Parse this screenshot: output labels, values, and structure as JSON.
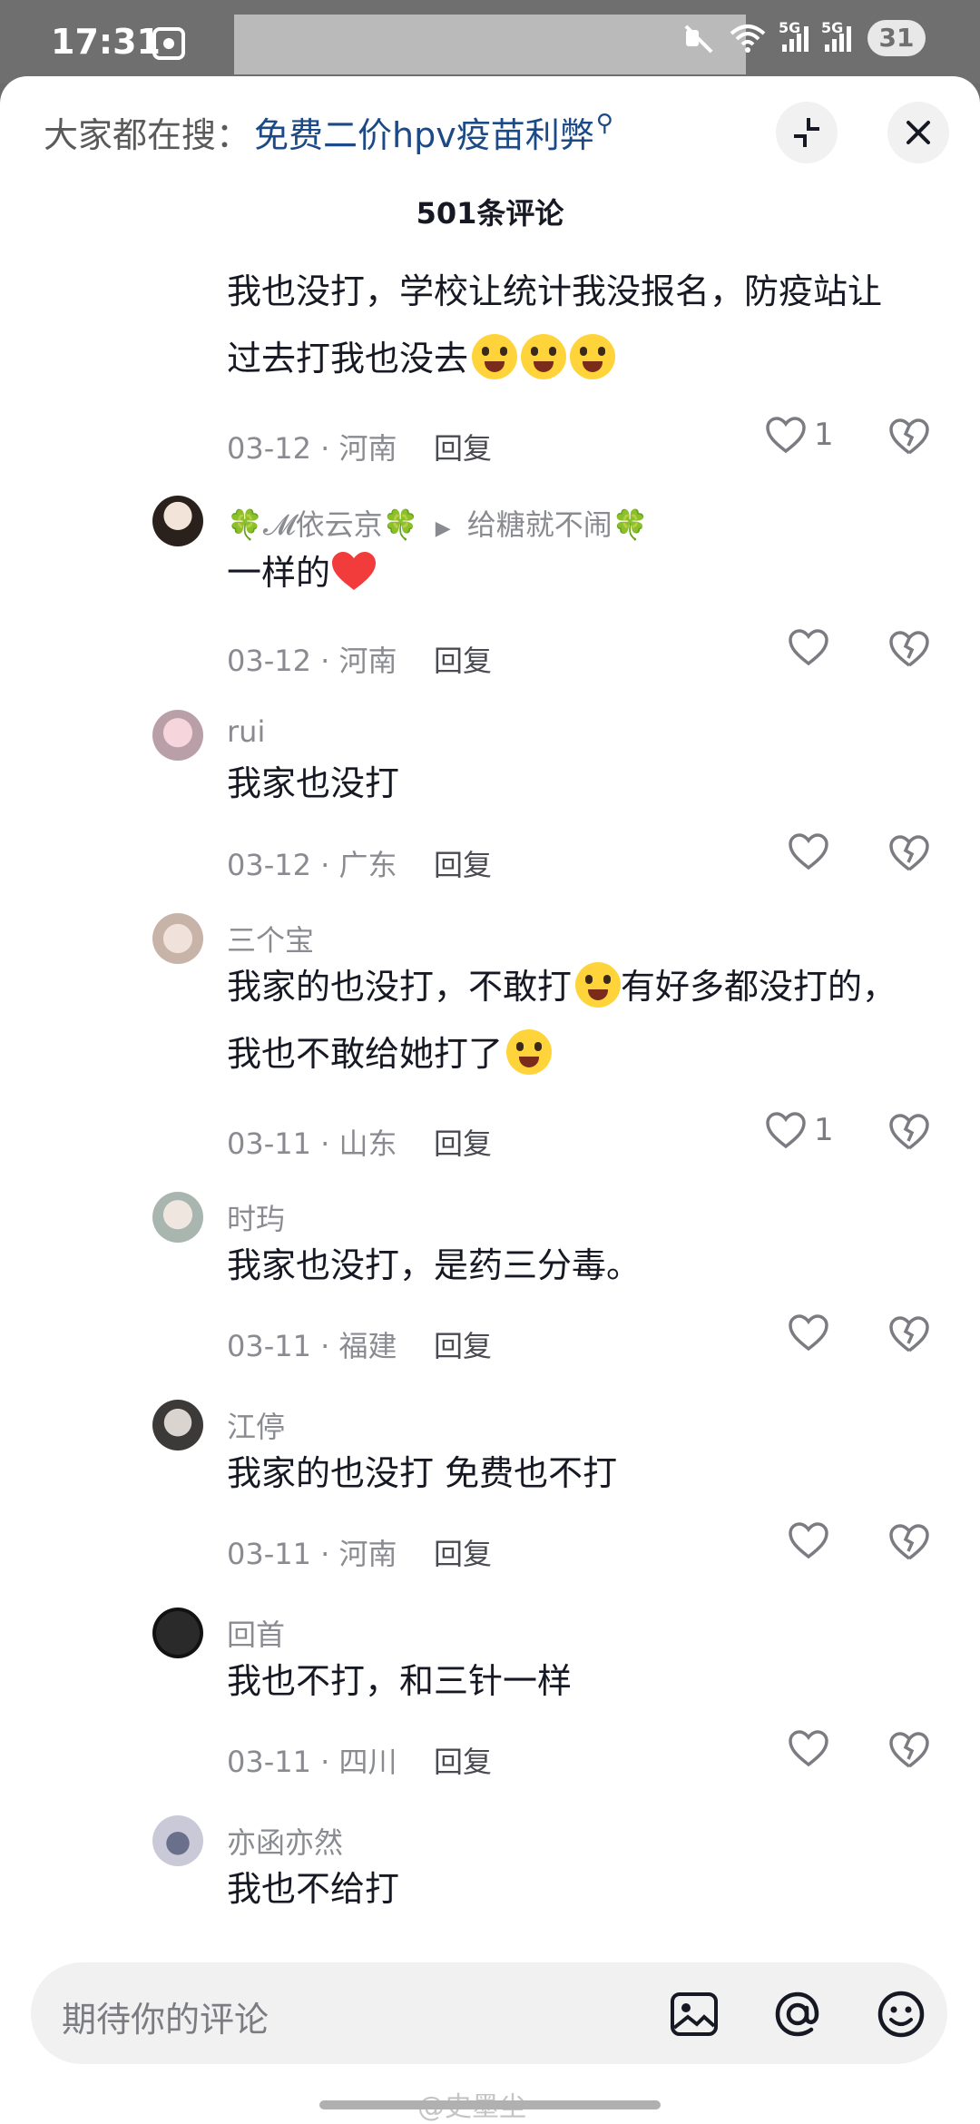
{
  "status_bar": {
    "time": "17:31",
    "network_1": "5G",
    "network_2": "5G",
    "battery": "31"
  },
  "header": {
    "search_label": "大家都在搜：",
    "search_term": "免费二价hpv疫苗利弊",
    "title": "501条评论"
  },
  "comments": [
    {
      "name": "",
      "text": "我也没打，学校让统计我没报名，防疫站让",
      "text2": "过去打我也没去",
      "date": "03-12 · 河南",
      "reply": "回复",
      "likes": "1"
    },
    {
      "name": "🍀𝓜依云京🍀",
      "reply_to": "给糖就不闹🍀",
      "text": "一样的",
      "date": "03-12 · 河南",
      "reply": "回复",
      "likes": ""
    },
    {
      "name": "rui",
      "text": "我家也没打",
      "date": "03-12 · 广东",
      "reply": "回复",
      "likes": ""
    },
    {
      "name": "三个宝",
      "text": "我家的也没打，不敢打",
      "text_b": "有好多都没打的，",
      "text2": "我也不敢给她打了",
      "date": "03-11 · 山东",
      "reply": "回复",
      "likes": "1"
    },
    {
      "name": "时玙",
      "text": "我家也没打，是药三分毒。",
      "date": "03-11 · 福建",
      "reply": "回复",
      "likes": ""
    },
    {
      "name": "江停",
      "text": "我家的也没打 免费也不打",
      "date": "03-11 · 河南",
      "reply": "回复",
      "likes": ""
    },
    {
      "name": "回首",
      "text": "我也不打，和三针一样",
      "date": "03-11 · 四川",
      "reply": "回复",
      "likes": ""
    },
    {
      "name": "亦函亦然",
      "text": "我也不给打"
    }
  ],
  "input": {
    "placeholder": "期待你的评论"
  },
  "watermark": "@史墨尘",
  "icons": [
    "mute-icon",
    "wifi-icon",
    "signal-icon",
    "collapse-icon",
    "close-icon",
    "heart-icon",
    "broken-heart-icon",
    "image-icon",
    "at-icon",
    "emoji-icon"
  ]
}
